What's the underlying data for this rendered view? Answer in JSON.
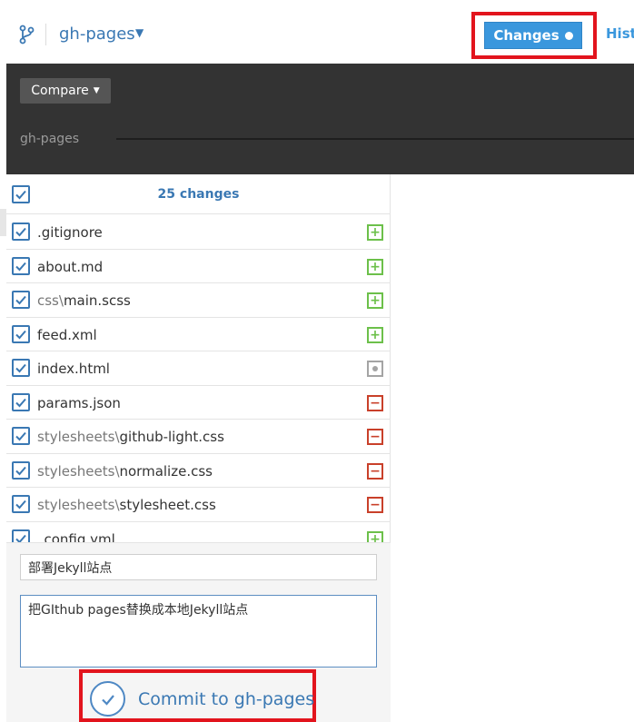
{
  "header": {
    "branch": "gh-pages",
    "changes_tab": "Changes",
    "history_tab": "Hist"
  },
  "compare": {
    "button": "Compare",
    "timeline_branch": "gh-pages"
  },
  "changes": {
    "count_label": "25 changes",
    "files": [
      {
        "dir": "",
        "name": ".gitignore",
        "status": "added"
      },
      {
        "dir": "",
        "name": "about.md",
        "status": "added"
      },
      {
        "dir": "css\\",
        "name": "main.scss",
        "status": "added"
      },
      {
        "dir": "",
        "name": "feed.xml",
        "status": "added"
      },
      {
        "dir": "",
        "name": "index.html",
        "status": "modified"
      },
      {
        "dir": "",
        "name": "params.json",
        "status": "deleted"
      },
      {
        "dir": "stylesheets\\",
        "name": "github-light.css",
        "status": "deleted"
      },
      {
        "dir": "stylesheets\\",
        "name": "normalize.css",
        "status": "deleted"
      },
      {
        "dir": "stylesheets\\",
        "name": "stylesheet.css",
        "status": "deleted"
      },
      {
        "dir": "",
        "name": "_config.yml",
        "status": "added"
      }
    ]
  },
  "commit": {
    "summary": "部署Jekyll站点",
    "description": "把GIthub pages替换成本地Jekyll站点",
    "button": "Commit to gh-pages"
  },
  "colors": {
    "accent": "#3a78b3",
    "button_blue": "#3a97dd",
    "added": "#6cc04a",
    "deleted": "#c9402a",
    "highlight": "#e2141d"
  },
  "icons": {
    "branch": "branch-icon",
    "checkbox": "check-icon",
    "commit": "checkmark-circle-icon"
  }
}
